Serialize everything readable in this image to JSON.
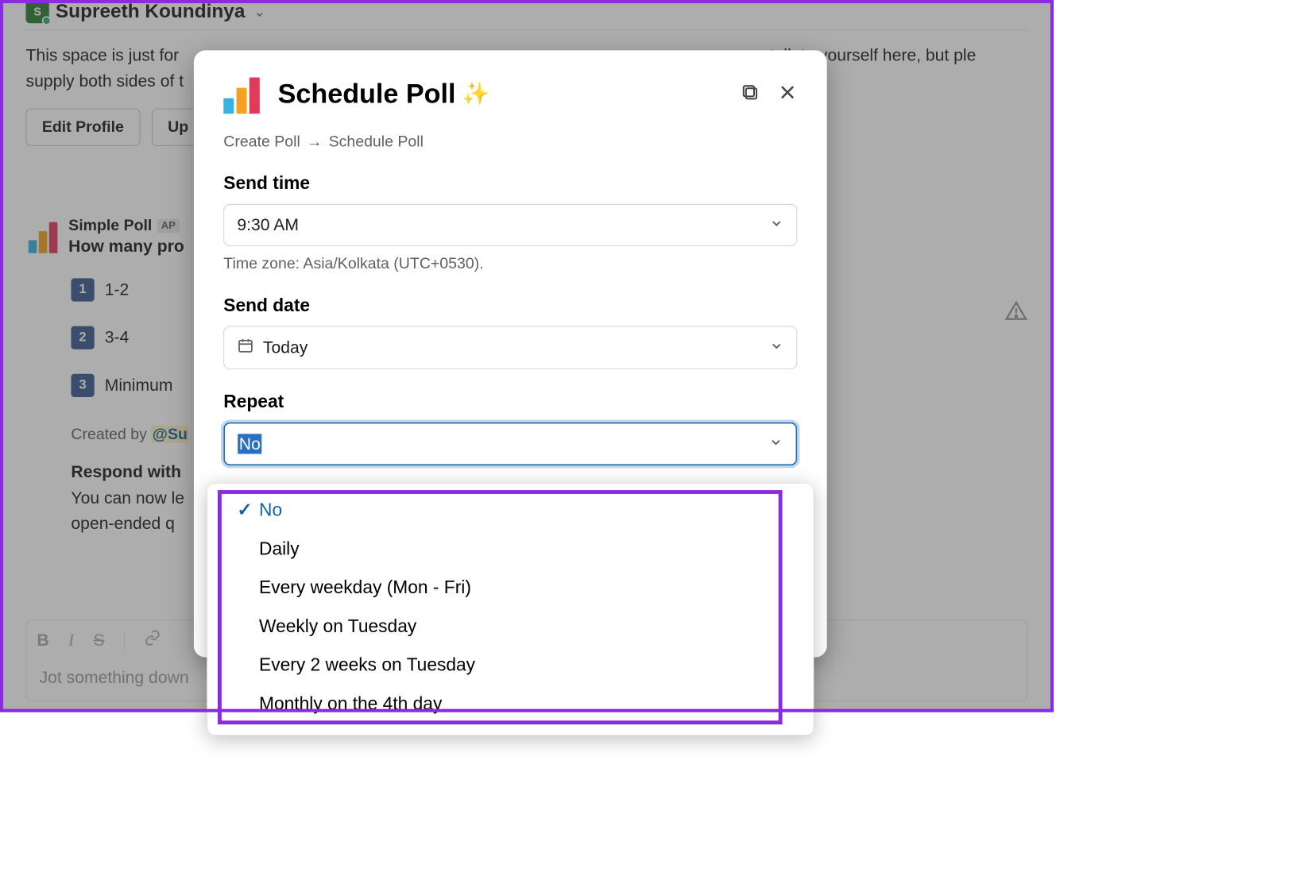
{
  "header": {
    "avatar_initials": "S",
    "user_name": "Supreeth Koundinya"
  },
  "intro": {
    "line1_prefix": "This space is just for",
    "line1_suffix_visible": "talk to yourself here, but ple",
    "line2_prefix": "supply both sides of t"
  },
  "buttons": {
    "edit_profile": "Edit Profile",
    "upload_partial": "Up"
  },
  "poll": {
    "app_name": "Simple Poll",
    "app_badge": "AP",
    "question_partial": "How many pro",
    "options": [
      {
        "num": "1",
        "label": "1-2"
      },
      {
        "num": "2",
        "label": "3-4"
      },
      {
        "num": "3",
        "label": "Minimum"
      }
    ],
    "created_by_prefix": "Created by ",
    "created_by_mention": "@Su",
    "respond_heading": "Respond with",
    "respond_line1": "You can now le",
    "respond_line2": "open-ended q"
  },
  "compose": {
    "placeholder": "Jot something down"
  },
  "modal": {
    "title": "Schedule Poll",
    "breadcrumb": {
      "a": "Create Poll",
      "b": "Schedule Poll"
    },
    "send_time_label": "Send time",
    "send_time_value": "9:30 AM",
    "timezone_note": "Time zone: Asia/Kolkata (UTC+0530).",
    "send_date_label": "Send date",
    "send_date_value": "Today",
    "repeat_label": "Repeat",
    "repeat_value": "No"
  },
  "dropdown": {
    "options": [
      "No",
      "Daily",
      "Every weekday (Mon - Fri)",
      "Weekly on Tuesday",
      "Every 2 weeks on Tuesday",
      "Monthly on the 4th day"
    ],
    "selected_index": 0
  }
}
